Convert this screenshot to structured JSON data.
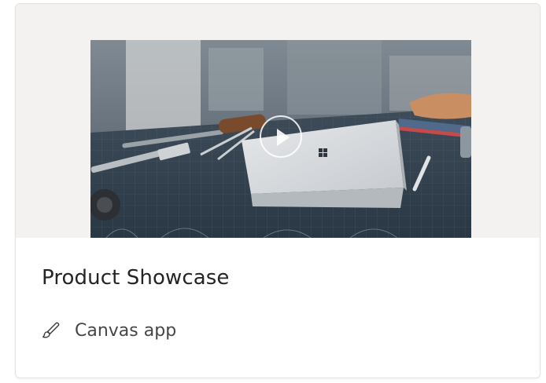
{
  "card": {
    "title": "Product Showcase",
    "type_label": "Canvas app",
    "type_icon": "pen-brush-icon",
    "thumbnail_icon": "play-icon"
  },
  "colors": {
    "hero_background": "#f3f2f1",
    "title_text": "#252423",
    "meta_text": "#484644",
    "card_border": "#e4e2e0"
  }
}
